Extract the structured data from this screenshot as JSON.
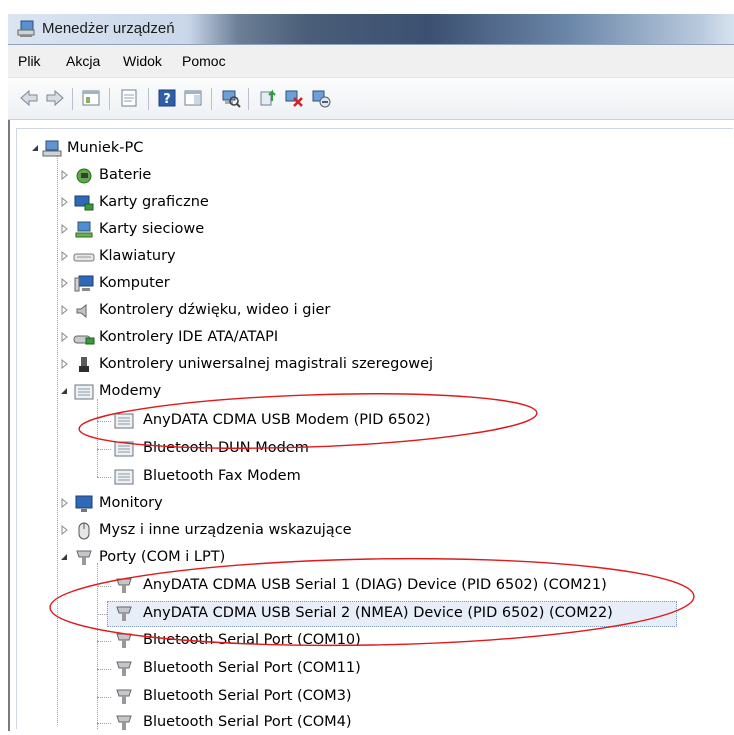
{
  "window": {
    "title": "Menedżer urządzeń"
  },
  "menu": [
    {
      "label": "Plik"
    },
    {
      "label": "Akcja"
    },
    {
      "label": "Widok"
    },
    {
      "label": "Pomoc"
    }
  ],
  "toolbar": {
    "buttons": [
      {
        "icon": "back-arrow-icon"
      },
      {
        "icon": "forward-arrow-icon"
      },
      {
        "icon": "show-hide-console-tree-icon"
      },
      {
        "icon": "properties-icon"
      },
      {
        "icon": "help-icon"
      },
      {
        "icon": "action-pane-icon"
      },
      {
        "icon": "scan-hardware-icon"
      },
      {
        "icon": "update-driver-icon"
      },
      {
        "icon": "uninstall-icon"
      },
      {
        "icon": "disable-device-icon"
      }
    ]
  },
  "tree": {
    "root": "Muniek-PC",
    "items": [
      {
        "label": "Baterie",
        "icon": "battery-icon"
      },
      {
        "label": "Karty graficzne",
        "icon": "display-adapter-icon"
      },
      {
        "label": "Karty sieciowe",
        "icon": "network-adapter-icon"
      },
      {
        "label": "Klawiatury",
        "icon": "keyboard-icon"
      },
      {
        "label": "Komputer",
        "icon": "computer-icon"
      },
      {
        "label": "Kontrolery dźwięku, wideo i gier",
        "icon": "speaker-icon"
      },
      {
        "label": "Kontrolery IDE ATA/ATAPI",
        "icon": "ide-controller-icon"
      },
      {
        "label": "Kontrolery uniwersalnej magistrali szeregowej",
        "icon": "usb-icon"
      },
      {
        "label": "Modemy",
        "icon": "modem-icon"
      },
      {
        "label": "AnyDATA CDMA USB Modem (PID 6502)",
        "icon": "modem-icon"
      },
      {
        "label": "Bluetooth DUN Modem",
        "icon": "modem-icon"
      },
      {
        "label": "Bluetooth Fax Modem",
        "icon": "modem-icon"
      },
      {
        "label": "Monitory",
        "icon": "monitor-icon"
      },
      {
        "label": "Mysz i inne urządzenia wskazujące",
        "icon": "mouse-icon"
      },
      {
        "label": "Porty (COM i LPT)",
        "icon": "port-icon"
      },
      {
        "label": "AnyDATA CDMA USB Serial 1 (DIAG) Device (PID 6502) (COM21)",
        "icon": "port-icon"
      },
      {
        "label": "AnyDATA CDMA USB Serial 2 (NMEA) Device (PID 6502) (COM22)",
        "icon": "port-icon"
      },
      {
        "label": "Bluetooth Serial Port (COM10)",
        "icon": "port-icon"
      },
      {
        "label": "Bluetooth Serial Port (COM11)",
        "icon": "port-icon"
      },
      {
        "label": "Bluetooth Serial Port (COM3)",
        "icon": "port-icon"
      },
      {
        "label": "Bluetooth Serial Port (COM4)",
        "icon": "port-icon"
      }
    ]
  },
  "colors": {
    "annotation": "#e0191b",
    "selection": "#e7eef8"
  }
}
